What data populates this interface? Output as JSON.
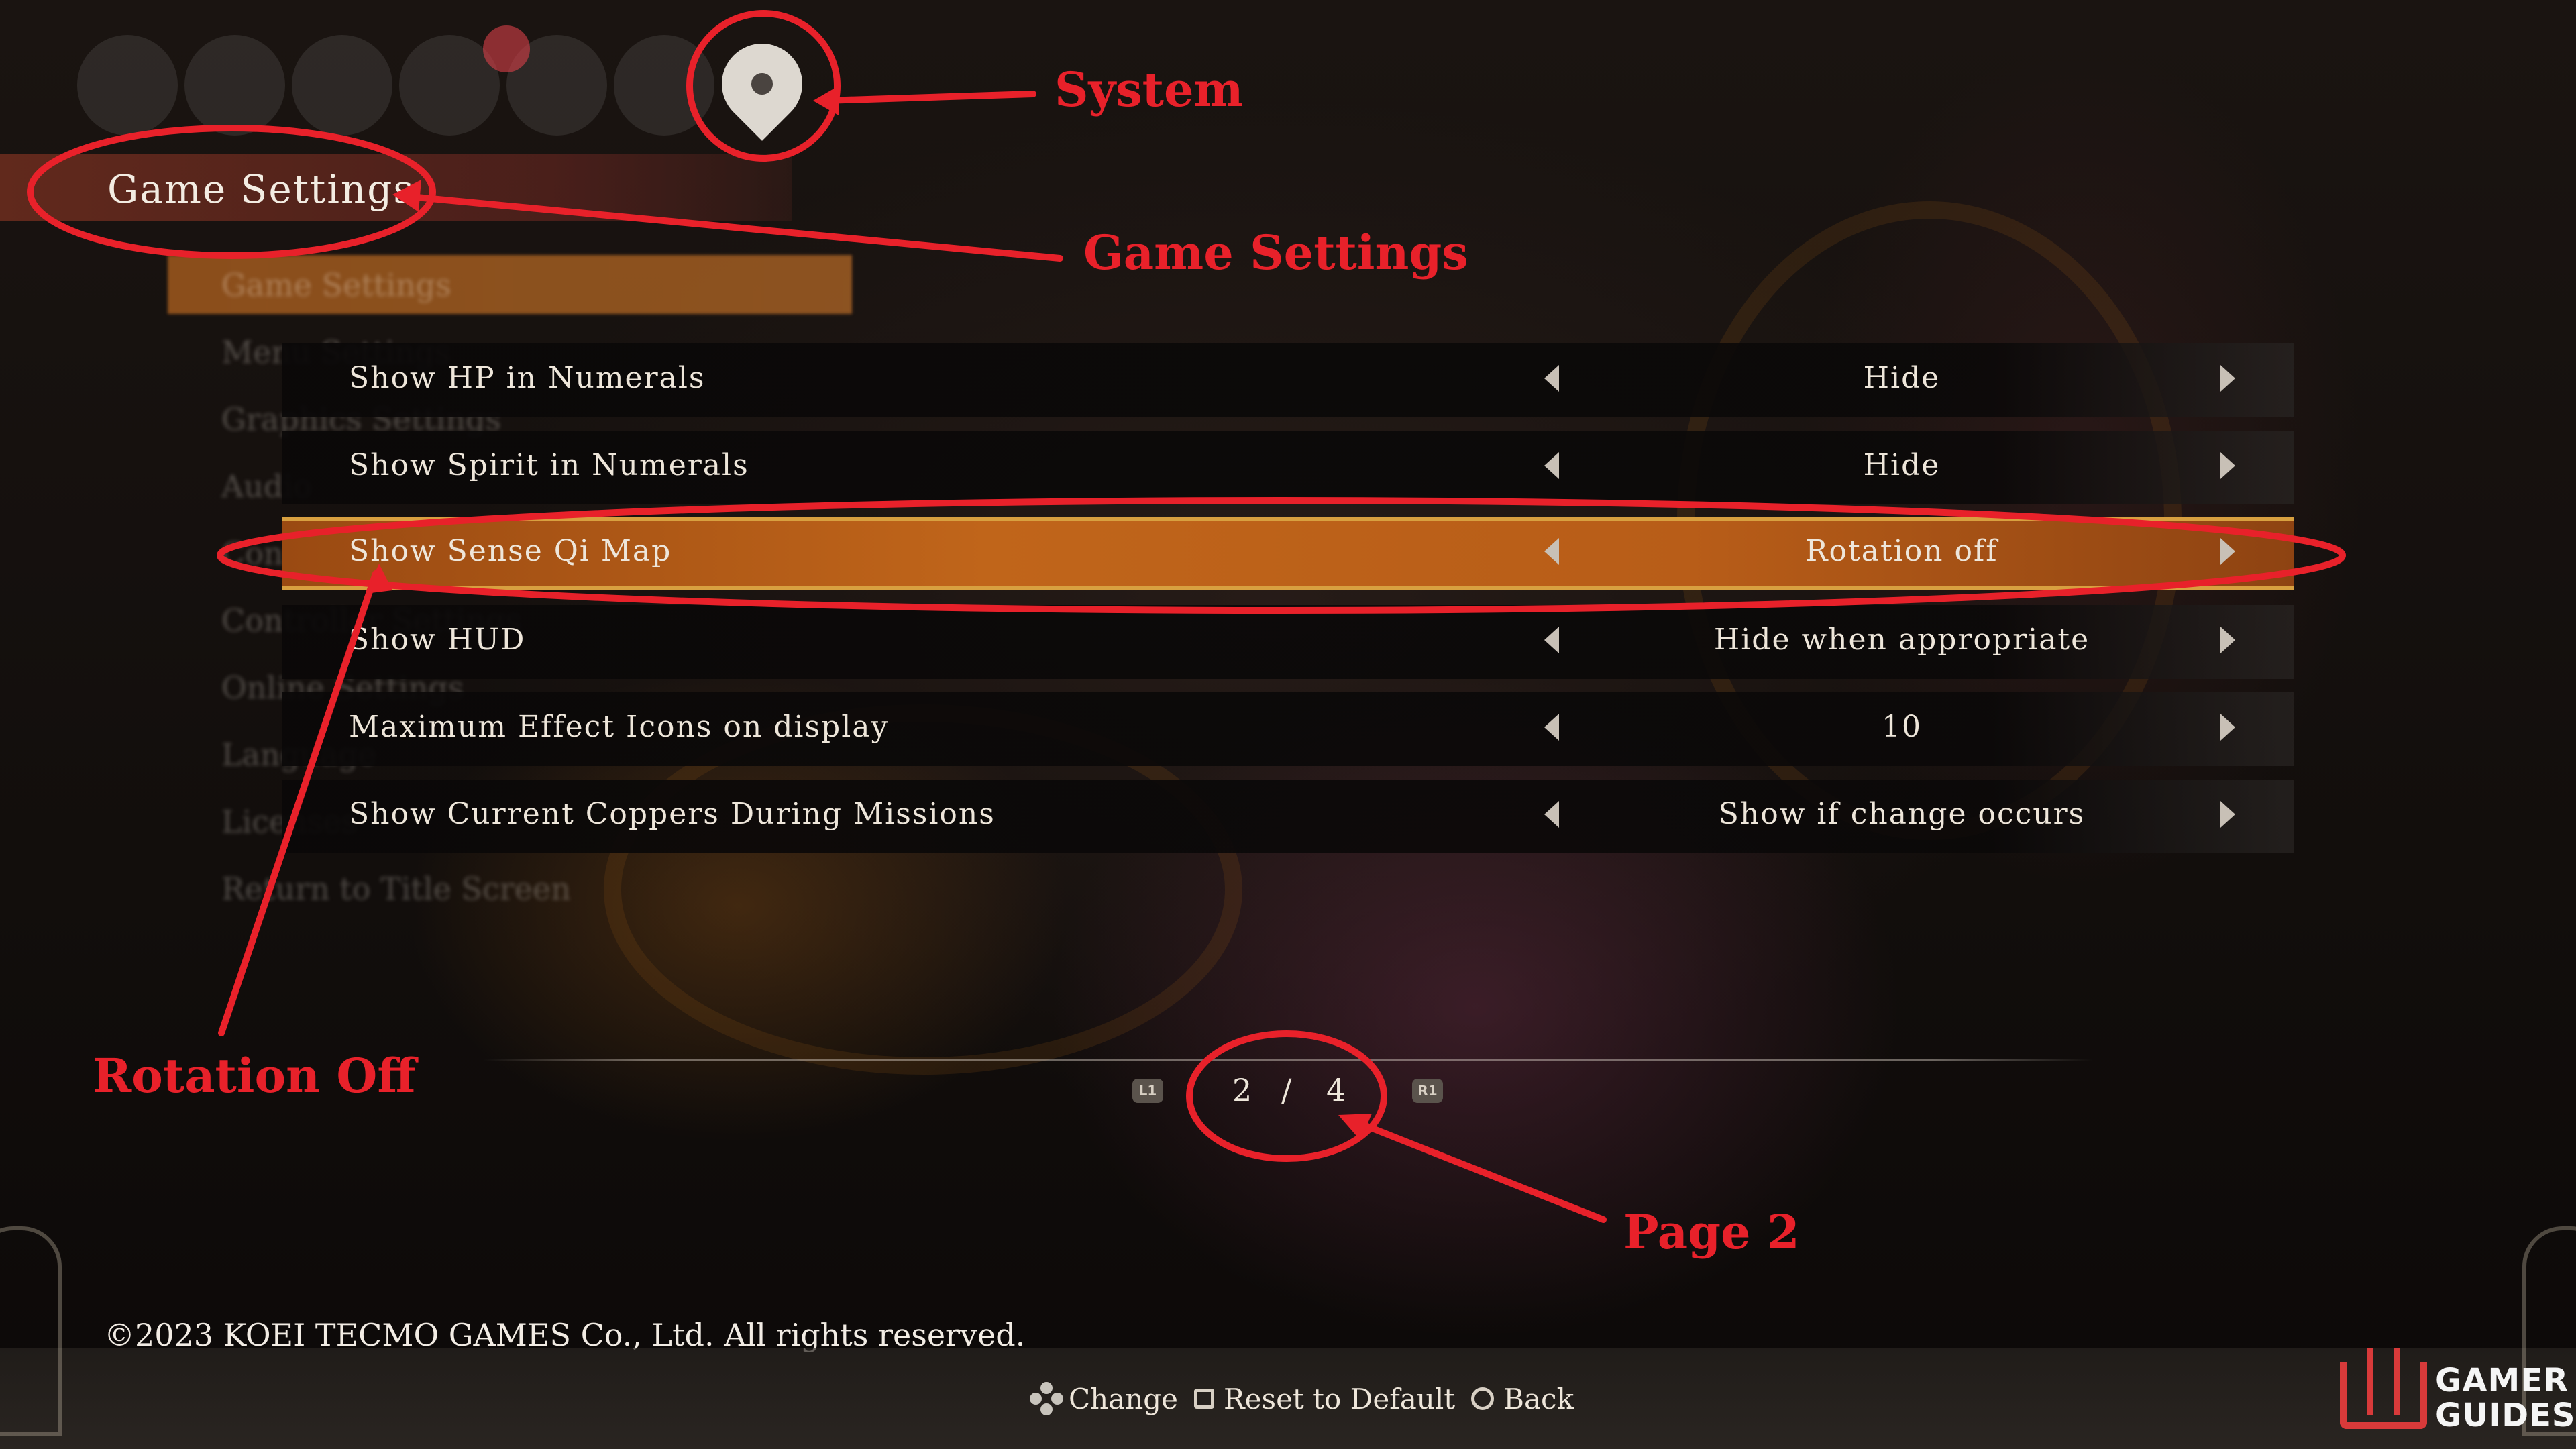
{
  "header": {
    "title": "Game Settings"
  },
  "left_menu": {
    "items": [
      "Game Settings",
      "Menu Settings",
      "Graphics Settings",
      "Audio",
      "Controls",
      "Controller Settings",
      "Online Settings",
      "Language",
      "Licenses",
      "Return to Title Screen"
    ]
  },
  "settings": [
    {
      "label": "Show HP in Numerals",
      "value": "Hide",
      "selected": false
    },
    {
      "label": "Show Spirit in Numerals",
      "value": "Hide",
      "selected": false
    },
    {
      "label": "Show Sense Qi Map",
      "value": "Rotation off",
      "selected": true
    },
    {
      "label": "Show HUD",
      "value": "Hide when appropriate",
      "selected": false
    },
    {
      "label": "Maximum Effect Icons on display",
      "value": "10",
      "selected": false
    },
    {
      "label": "Show Current Coppers During Missions",
      "value": "Show if change occurs",
      "selected": false
    }
  ],
  "pagination": {
    "prev_button": "L1",
    "next_button": "R1",
    "current": "2",
    "separator": "/",
    "total": "4"
  },
  "copyright": "©2023 KOEI TECMO GAMES Co., Ltd. All rights reserved.",
  "footer": {
    "change": "Change",
    "reset": "Reset to Default",
    "back": "Back"
  },
  "annotations": {
    "system": "System",
    "game_settings": "Game Settings",
    "rotation_off": "Rotation Off",
    "page": "Page 2",
    "color": "#e8212a"
  },
  "watermark": {
    "line1": "GAMER",
    "line2": "GUIDES"
  },
  "colors": {
    "selected_row": "#c0651a",
    "header_bar": "#6e2d1e"
  }
}
